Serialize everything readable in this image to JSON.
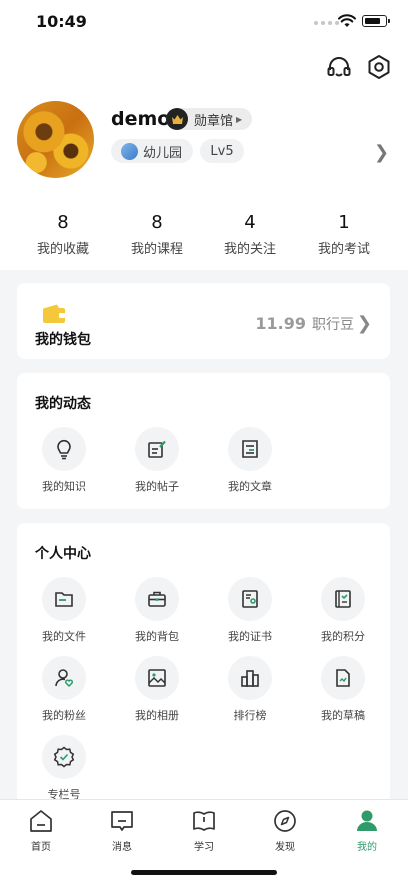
{
  "status_bar": {
    "time": "10:49"
  },
  "profile": {
    "username": "demo",
    "medal_label": "勋章馆",
    "grade": "幼儿园",
    "level": "Lv5"
  },
  "stats": [
    {
      "count": "8",
      "label": "我的收藏"
    },
    {
      "count": "8",
      "label": "我的课程"
    },
    {
      "count": "4",
      "label": "我的关注"
    },
    {
      "count": "1",
      "label": "我的考试"
    }
  ],
  "wallet": {
    "title": "我的钱包",
    "amount": "11.99",
    "unit": "职行豆"
  },
  "dynamics": {
    "title": "我的动态",
    "items": [
      {
        "label": "我的知识",
        "icon": "lightbulb-icon"
      },
      {
        "label": "我的帖子",
        "icon": "edit-post-icon"
      },
      {
        "label": "我的文章",
        "icon": "article-icon"
      }
    ]
  },
  "personal_center": {
    "title": "个人中心",
    "items": [
      {
        "label": "我的文件",
        "icon": "folder-icon"
      },
      {
        "label": "我的背包",
        "icon": "briefcase-icon"
      },
      {
        "label": "我的证书",
        "icon": "certificate-icon"
      },
      {
        "label": "我的积分",
        "icon": "points-icon"
      },
      {
        "label": "我的粉丝",
        "icon": "fans-icon"
      },
      {
        "label": "我的相册",
        "icon": "photo-album-icon"
      },
      {
        "label": "排行榜",
        "icon": "ranking-icon"
      },
      {
        "label": "我的草稿",
        "icon": "draft-icon"
      },
      {
        "label": "专栏号",
        "icon": "column-badge-icon"
      }
    ]
  },
  "tab_bar": {
    "active_color": "#2f9b6b",
    "tabs": [
      {
        "label": "首页",
        "icon": "home-icon"
      },
      {
        "label": "消息",
        "icon": "message-icon"
      },
      {
        "label": "学习",
        "icon": "book-icon"
      },
      {
        "label": "发现",
        "icon": "compass-icon"
      },
      {
        "label": "我的",
        "icon": "person-icon"
      }
    ]
  }
}
